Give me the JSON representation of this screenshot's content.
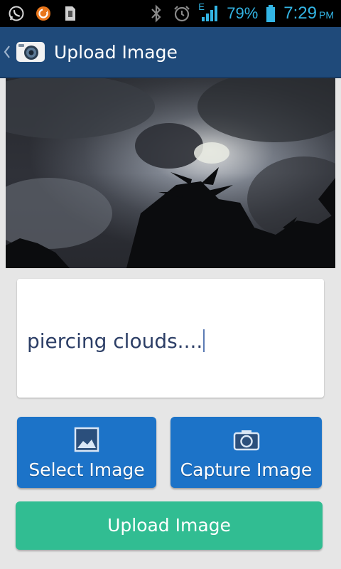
{
  "status_bar": {
    "left_icons": [
      "whatsapp-icon",
      "app-notification-icon",
      "sim-file-icon"
    ],
    "right_icons": [
      "bluetooth-icon",
      "alarm-icon",
      "signal-icon",
      "battery-icon"
    ],
    "network_type": "E",
    "battery": "79%",
    "time": "7:29",
    "ampm": "PM",
    "accent_color": "#33b5e5"
  },
  "action_bar": {
    "title": "Upload Image",
    "background_color": "#1f4a7a",
    "icons": [
      "back-chevron-icon",
      "camera-logo-icon"
    ]
  },
  "photo": {
    "subject": "dark clouds with sun behind, palm tree silhouettes"
  },
  "caption": {
    "value": "piercing clouds...."
  },
  "buttons": {
    "select_label": "Select Image",
    "capture_label": "Capture Image",
    "upload_label": "Upload Image",
    "select_icon": "image-gallery-icon",
    "capture_icon": "camera-icon",
    "blue_color": "#1c73c8",
    "green_color": "#31bd92"
  }
}
